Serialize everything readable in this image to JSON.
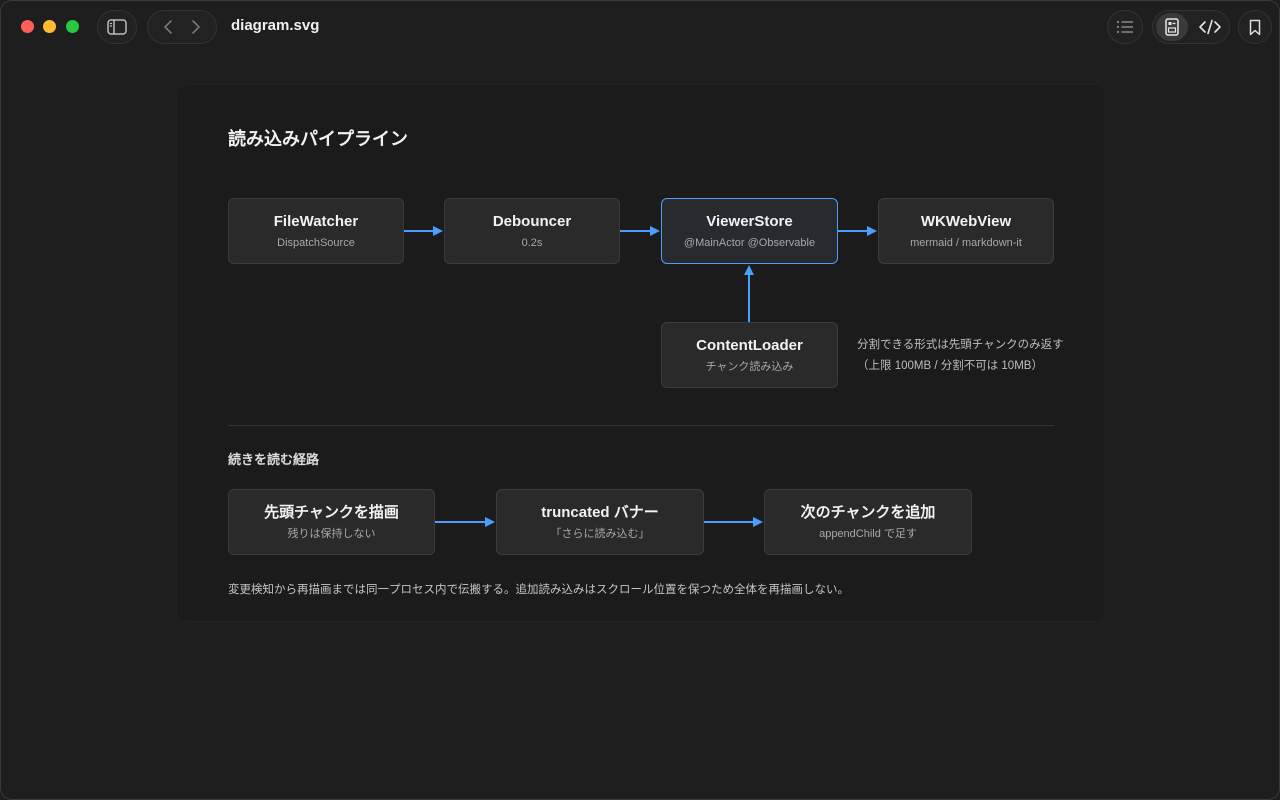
{
  "window": {
    "title": "diagram.svg"
  },
  "toolbar": {
    "sidebar_icon": "sidebar-icon",
    "back_icon": "chevron-left-icon",
    "forward_icon": "chevron-right-icon",
    "toc_icon": "list-icon",
    "preview_icon": "preview-icon",
    "source_icon": "code-icon",
    "bookmark_icon": "bookmark-icon"
  },
  "diagram": {
    "title": "読み込みパイプライン",
    "pipeline": [
      {
        "title": "FileWatcher",
        "sub": "DispatchSource"
      },
      {
        "title": "Debouncer",
        "sub": "0.2s"
      },
      {
        "title": "ViewerStore",
        "sub": "@MainActor @Observable"
      },
      {
        "title": "WKWebView",
        "sub": "mermaid / markdown-it"
      }
    ],
    "loader": {
      "title": "ContentLoader",
      "sub": "チャンク読み込み"
    },
    "note": {
      "line1": "分割できる形式は先頭チャンクのみ返す",
      "line2": "（上限 100MB / 分割不可は 10MB）"
    },
    "section_title": "続きを読む経路",
    "continuation": [
      {
        "title": "先頭チャンクを描画",
        "sub": "残りは保持しない"
      },
      {
        "title": "truncated バナー",
        "sub": "「さらに読み込む」"
      },
      {
        "title": "次のチャンクを追加",
        "sub": "appendChild で足す"
      }
    ],
    "footer": "変更検知から再描画までは同一プロセス内で伝搬する。追加読み込みはスクロール位置を保つため全体を再描画しない。"
  },
  "colors": {
    "accent": "#4a9eff",
    "node_bg": "#2a2a2a",
    "node_border": "#3c3c3c"
  }
}
